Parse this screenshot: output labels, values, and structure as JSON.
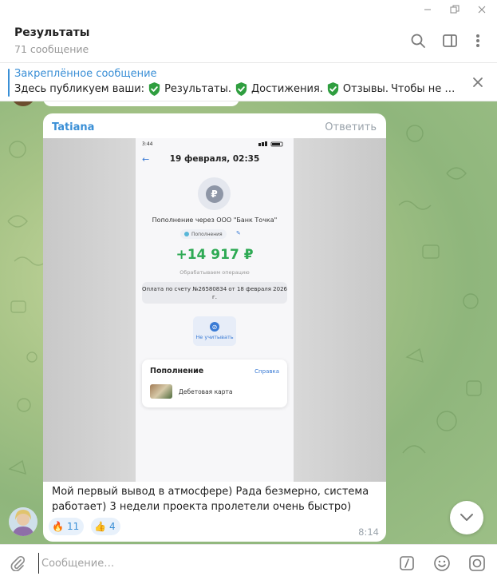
{
  "header": {
    "title": "Результаты",
    "subtitle": "71 сообщение"
  },
  "pinned": {
    "title": "Закреплённое сообщение",
    "segments": [
      "Здесь публикуем ваши:",
      "Результаты.",
      "Достижения.",
      "Отзывы.",
      "Чтобы не …"
    ]
  },
  "message": {
    "sender": "Tatiana",
    "reply_label": "Ответить",
    "text": "Мой первый вывод в атмосфере) Рада безмерно, система работает) 3 недели проекта пролетели очень быстро)",
    "time": "8:14",
    "reactions": [
      {
        "emoji": "🔥",
        "count": "11"
      },
      {
        "emoji": "👍",
        "count": "4"
      }
    ]
  },
  "receipt": {
    "status_time": "3:44",
    "date": "19 февраля, 02:35",
    "rub_sign": "₽",
    "description": "Пополнение через ООО \"Банк Точка\"",
    "category": "Пополнения",
    "amount": "+14 917 ₽",
    "processing": "Обрабатываем операцию",
    "payment_note": "Оплата по счету №26580834 от 18 февраля 2026 г.",
    "ignore_label": "Не учитывать",
    "card_title": "Пополнение",
    "card_link": "Справка",
    "card_sub": "Дебетовая карта"
  },
  "composer": {
    "placeholder": "Сообщение…"
  },
  "colors": {
    "accent": "#3a8fd6",
    "amount_green": "#2eaa54",
    "shield_green": "#2f9e3f"
  }
}
